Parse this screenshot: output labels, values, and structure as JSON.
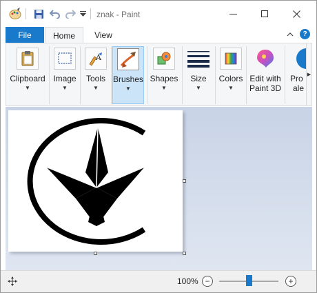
{
  "window": {
    "title": "znak - Paint",
    "controls": {
      "minimize": "—",
      "maximize": "☐",
      "close": "✕"
    }
  },
  "quick_access": {
    "icons": [
      "paint-app-icon",
      "save-icon",
      "undo-icon",
      "redo-icon",
      "customize-dropdown-icon"
    ]
  },
  "tabs": [
    {
      "label": "File"
    },
    {
      "label": "Home"
    },
    {
      "label": "View"
    }
  ],
  "ribbon": {
    "groups": [
      {
        "label": "Clipboard",
        "icon": "clipboard-icon"
      },
      {
        "label": "Image",
        "icon": "select-icon"
      },
      {
        "label": "Tools",
        "icon": "tools-icon"
      },
      {
        "label": "Brushes",
        "icon": "brush-icon",
        "selected": true
      },
      {
        "label": "Shapes",
        "icon": "shapes-icon"
      },
      {
        "label": "Size",
        "icon": "line-size-icon"
      },
      {
        "label": "Colors",
        "icon": "colors-icon"
      },
      {
        "label": "Edit with",
        "label2": "Paint 3D",
        "icon": "paint3d-icon"
      },
      {
        "label": "Pro",
        "label2": "ale",
        "icon": "product-alert-icon"
      }
    ],
    "collapse": "^",
    "help": "?"
  },
  "status": {
    "zoom": "100%",
    "zoom_out": "−",
    "zoom_in": "+",
    "zoom_slider_fraction": 0.5
  },
  "colors": {
    "accent": "#1979ca",
    "selected_group": "#cce4f7",
    "workspace": "#c8d3e6"
  }
}
